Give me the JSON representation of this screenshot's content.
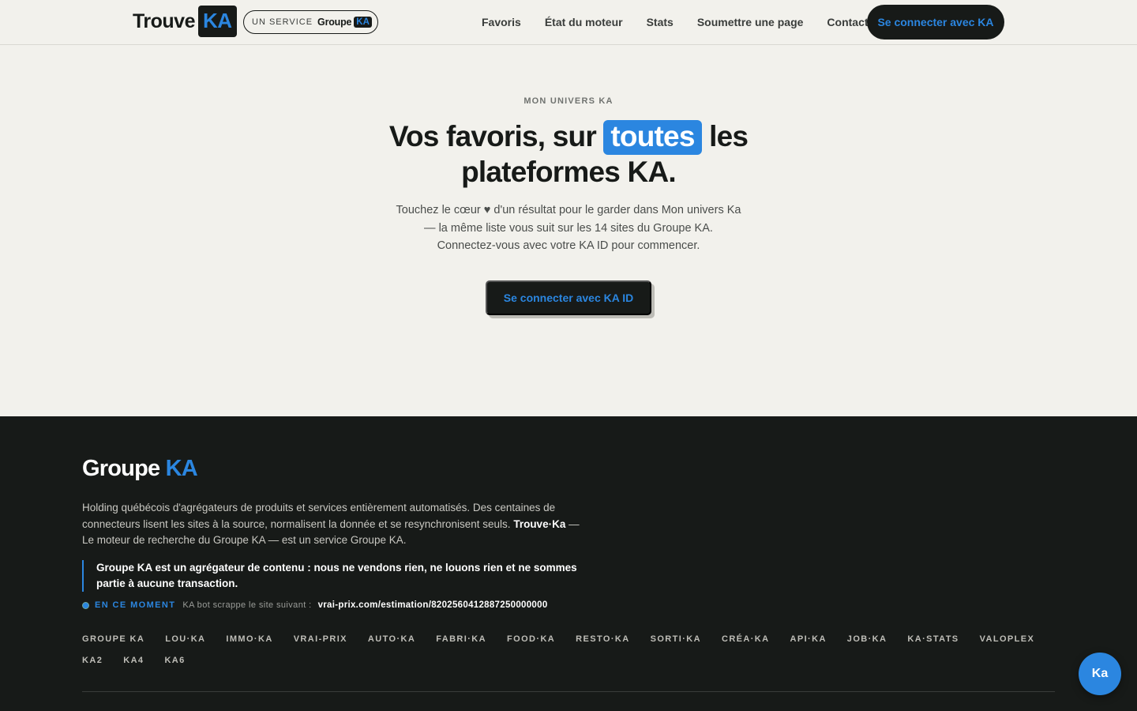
{
  "header": {
    "logo_text": "Trouve",
    "logo_badge": "KA",
    "service_prefix": "UN SERVICE",
    "service_group": "Groupe",
    "service_badge": "KA",
    "nav": [
      {
        "label": "Favoris"
      },
      {
        "label": "État du moteur"
      },
      {
        "label": "Stats"
      },
      {
        "label": "Soumettre une page"
      },
      {
        "label": "Contact"
      }
    ],
    "login_button": "Se connecter avec KA"
  },
  "hero": {
    "eyebrow": "MON UNIVERS KA",
    "headline_before": "Vos favoris, sur",
    "headline_highlight": "toutes",
    "headline_after": "les plateformes KA.",
    "lead": "Touchez le cœur ♥ d'un résultat pour le garder dans Mon univers Ka — la même liste vous suit sur les 14 sites du Groupe KA. Connectez-vous avec votre KA ID pour commencer.",
    "cta": "Se connecter avec KA ID"
  },
  "footer": {
    "logo_main": "Groupe",
    "logo_accent": "KA",
    "description": "Holding québécois d'agrégateurs de produits et services entièrement automatisés. Des centaines de connecteurs lisent les sites à la source, normalisent la donnée et se resynchronisent seuls.",
    "description_brand": "Trouve·Ka",
    "description_tail": "— Le moteur de recherche du Groupe KA — est un service Groupe KA.",
    "disclaimer": "Groupe KA est un agrégateur de contenu : nous ne vendons rien, ne louons rien et ne sommes partie à aucune transaction.",
    "live_label": "EN CE MOMENT",
    "live_text": "KA bot scrappe le site suivant :",
    "live_url": "vrai-prix.com/estimation/8202560412887250000000",
    "sites": [
      "GROUPE KA",
      "LOU·KA",
      "IMMO·KA",
      "VRAI-PRIX",
      "AUTO·KA",
      "FABRI·KA",
      "FOOD·KA",
      "RESTO·KA",
      "SORTI·KA",
      "CRÉA·KA",
      "API·KA",
      "JOB·KA",
      "KA·STATS",
      "VALOPLEX",
      "KA2",
      "KA4",
      "KA6"
    ]
  },
  "chat": {
    "label": "Ka"
  },
  "colors": {
    "accent": "#2b86e0",
    "dark": "#171a18",
    "background": "#f2f1ec"
  }
}
